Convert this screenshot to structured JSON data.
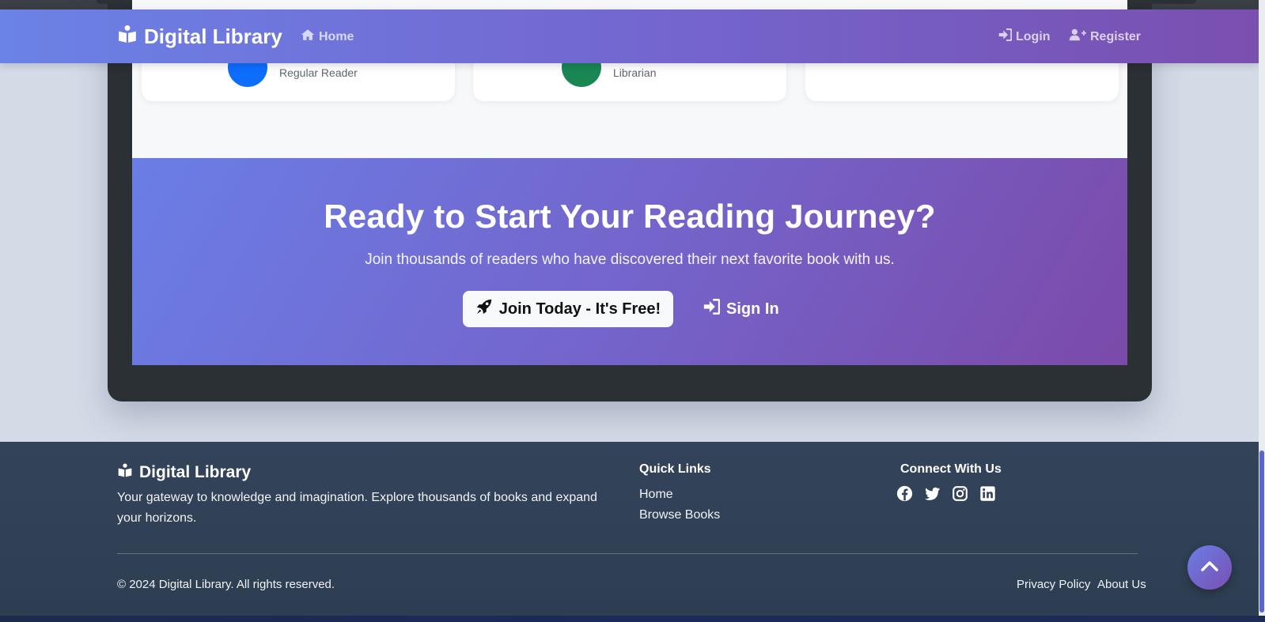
{
  "navbar": {
    "brand": "Digital Library",
    "home": "Home",
    "login": "Login",
    "register": "Register"
  },
  "cards": [
    {
      "role": "Regular Reader",
      "avatar_color": "#0d6efd"
    },
    {
      "role": "Librarian",
      "avatar_color": "#198754"
    },
    {
      "role": ""
    }
  ],
  "cta": {
    "title": "Ready to Start Your Reading Journey?",
    "subtitle": "Join thousands of readers who have discovered their next favorite book with us.",
    "join_button": "Join Today - It's Free!",
    "signin_button": "Sign In"
  },
  "footer": {
    "brand": "Digital Library",
    "description": "Your gateway to knowledge and imagination. Explore thousands of books and expand your horizons.",
    "quick_links_heading": "Quick Links",
    "quick_links": [
      "Home",
      "Browse Books"
    ],
    "connect_heading": "Connect With Us",
    "social_icons": [
      "facebook-icon",
      "twitter-icon",
      "instagram-icon",
      "linkedin-icon"
    ],
    "copyright": "© 2024 Digital Library. All rights reserved.",
    "bottom_links": [
      "Privacy Policy",
      "About Us"
    ]
  },
  "colors": {
    "accent_start": "#6b82e6",
    "accent_end": "#7a4fb0",
    "footer_bg": "#33435a"
  }
}
